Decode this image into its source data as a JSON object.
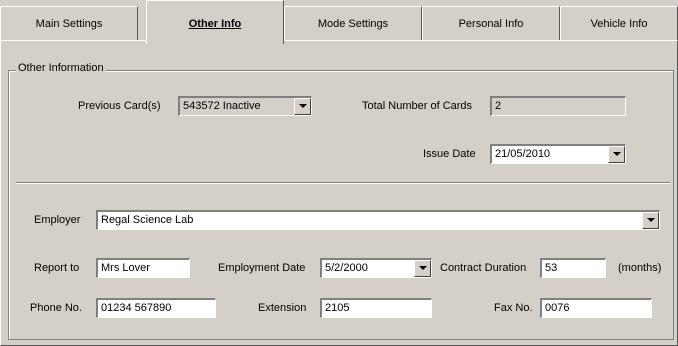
{
  "tabs": [
    {
      "label": "Main Settings",
      "active": false
    },
    {
      "label": "Other Info",
      "active": true
    },
    {
      "label": "Mode Settings",
      "active": false
    },
    {
      "label": "Personal Info",
      "active": false
    },
    {
      "label": "Vehicle Info",
      "active": false
    }
  ],
  "group": {
    "title": "Other Information"
  },
  "form": {
    "previous_cards_label": "Previous Card(s)",
    "previous_cards_value": "543572 Inactive",
    "total_cards_label": "Total Number of Cards",
    "total_cards_value": "2",
    "issue_date_label": "Issue Date",
    "issue_date_value": "21/05/2010",
    "employer_label": "Employer",
    "employer_value": "Regal Science Lab",
    "report_to_label": "Report to",
    "report_to_value": "Mrs Lover",
    "employment_date_label": "Employment Date",
    "employment_date_value": "5/2/2000",
    "contract_duration_label": "Contract Duration",
    "contract_duration_value": "53",
    "contract_duration_unit": "(months)",
    "phone_label": "Phone No.",
    "phone_value": "01234 567890",
    "extension_label": "Extension",
    "extension_value": "2105",
    "fax_label": "Fax No.",
    "fax_value": "0076"
  },
  "icons": {
    "dropdown": "chevron-down-icon"
  }
}
